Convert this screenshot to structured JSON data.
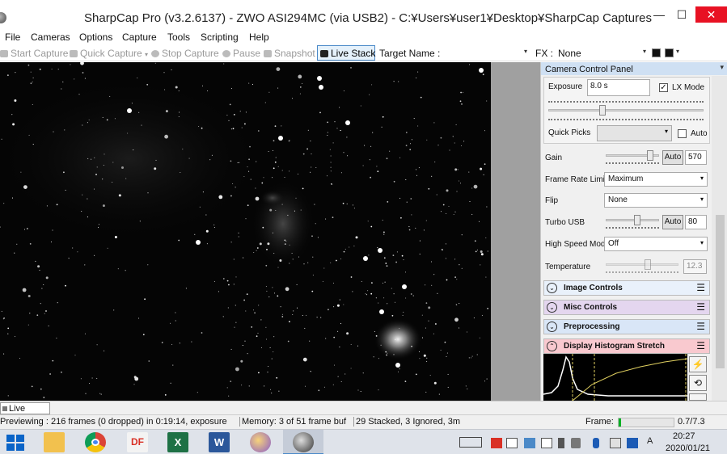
{
  "window": {
    "title": "SharpCap Pro (v3.2.6137) - ZWO ASI294MC (via USB2) - C:¥Users¥user1¥Desktop¥SharpCap Captures",
    "minimize": "—",
    "maximize": "☐",
    "close": "✕"
  },
  "menu": [
    "File",
    "Cameras",
    "Options",
    "Capture",
    "Tools",
    "Scripting",
    "Help"
  ],
  "toolbar": {
    "start_capture": "Start Capture",
    "quick_capture": "Quick Capture",
    "stop_capture": "Stop Capture",
    "pause": "Pause",
    "snapshot": "Snapshot",
    "live_stack": "Live Stack",
    "target_name_label": "Target Name :",
    "fx_label": "FX :",
    "fx_value": "None"
  },
  "panel": {
    "title": "Camera Control Panel",
    "exposure_label": "Exposure",
    "exposure_value": "8.0 s",
    "lx_mode_label": "LX Mode",
    "lx_mode_checked": true,
    "quick_picks_label": "Quick Picks",
    "quick_picks_value": "",
    "auto_label": "Auto",
    "auto_checked": false,
    "gain_label": "Gain",
    "gain_auto": "Auto",
    "gain_value": "570",
    "gain_level": 0.88,
    "frame_rate_label": "Frame Rate Limit",
    "frame_rate_value": "Maximum",
    "flip_label": "Flip",
    "flip_value": "None",
    "turbo_usb_label": "Turbo USB",
    "turbo_usb_auto": "Auto",
    "turbo_usb_value": "80",
    "turbo_usb_level": 0.6,
    "high_speed_label": "High Speed Mode",
    "high_speed_value": "Off",
    "temperature_label": "Temperature",
    "temperature_value": "12.3",
    "temperature_level": 0.58,
    "exposure_level": 0.34
  },
  "sections": [
    {
      "label": "Image Controls",
      "color": "#e9f1fb",
      "expanded": false
    },
    {
      "label": "Misc Controls",
      "color": "#e4d6ef",
      "expanded": false
    },
    {
      "label": "Preprocessing",
      "color": "#d9e6f7",
      "expanded": false
    },
    {
      "label": "Display Histogram Stretch",
      "color": "#f9c9cf",
      "expanded": true
    }
  ],
  "icons": {
    "chevron_down": "⌄",
    "chevron_up": "⌃",
    "menu": "☰",
    "lightning": "⚡",
    "reset": "⟲",
    "checkmark": "✓",
    "dropdown": "▾"
  },
  "tab": {
    "live_stack": "Live Stack"
  },
  "status": {
    "previewing": "Previewing : 216 frames (0 dropped) in 0:19:14, exposure",
    "memory": "Memory: 3 of 51 frame buf",
    "stacked": "29 Stacked, 3 Ignored, 3m",
    "frame_label": "Frame:",
    "frame_progress": 0.04,
    "ratio": "0.7/7.3"
  },
  "taskbar": {
    "time": "20:27",
    "date": "2020/01/21",
    "ime": "A",
    "df_label": "DF",
    "excel_label": "X",
    "word_label": "W"
  }
}
